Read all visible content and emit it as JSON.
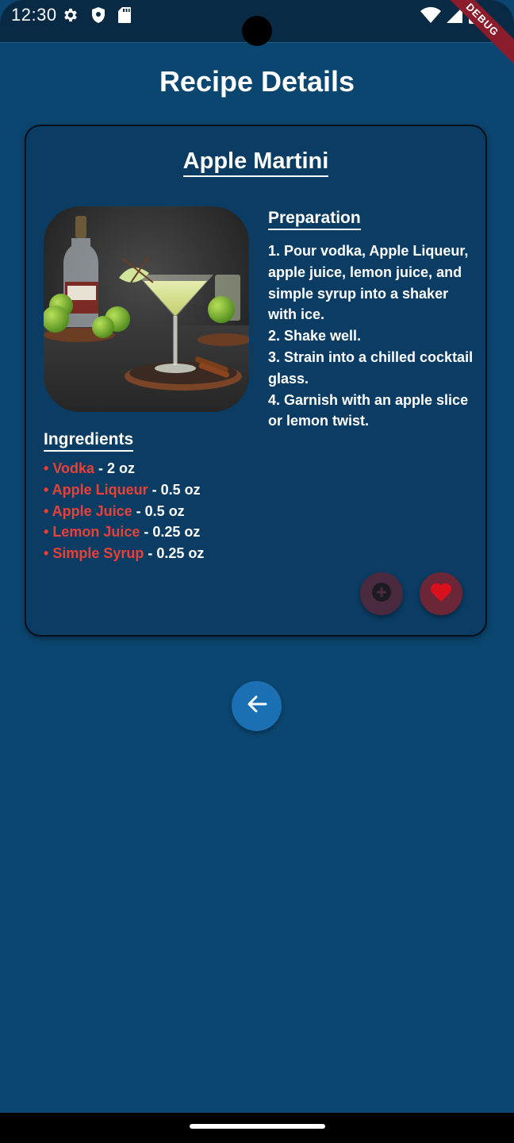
{
  "status_bar": {
    "time": "12:30",
    "debug_label": "DEBUG"
  },
  "page": {
    "title": "Recipe Details"
  },
  "recipe": {
    "name": "Apple Martini",
    "image_alt": "apple-martini-photo",
    "preparation_heading": "Preparation",
    "preparation_steps": [
      "1. Pour vodka, Apple Liqueur, apple juice, lemon juice, and simple syrup into a shaker with ice.",
      "2. Shake well.",
      "3. Strain into a chilled cocktail glass.",
      "4. Garnish with an apple slice or lemon twist."
    ],
    "ingredients_heading": "Ingredients",
    "ingredients": [
      {
        "bullet": "• ",
        "name": "Vodka",
        "amount": " - 2 oz"
      },
      {
        "bullet": "• ",
        "name": "Apple Liqueur",
        "amount": " - 0.5 oz"
      },
      {
        "bullet": "• ",
        "name": "Apple Juice",
        "amount": " - 0.5 oz"
      },
      {
        "bullet": "• ",
        "name": "Lemon Juice",
        "amount": " - 0.25 oz"
      },
      {
        "bullet": "• ",
        "name": "Simple Syrup",
        "amount": " - 0.25 oz"
      }
    ]
  },
  "actions": {
    "add_icon": "add-circle-icon",
    "favorite_icon": "heart-icon",
    "back_icon": "arrow-back-icon"
  },
  "colors": {
    "background": "#0b4670",
    "card": "#0b3c63",
    "ingredient_name": "#e8413a",
    "back_button": "#1b6fb3",
    "favorite": "#d80f1c"
  }
}
